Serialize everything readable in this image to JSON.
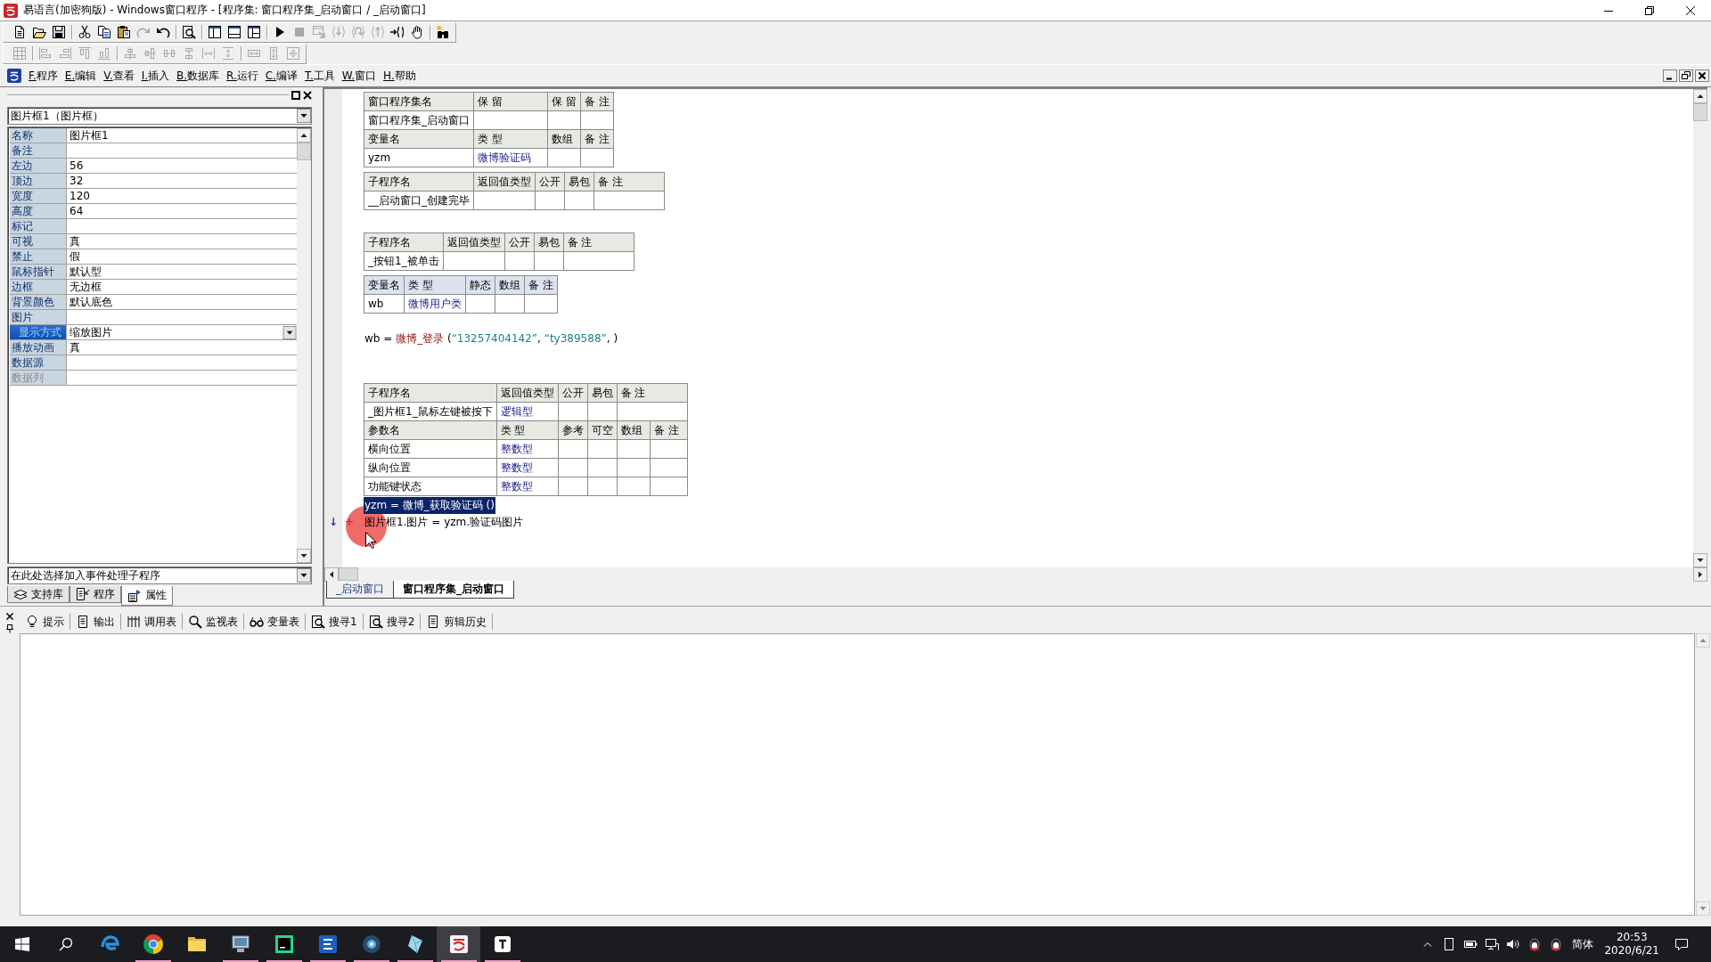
{
  "window": {
    "title": "易语言(加密狗版) - Windows窗口程序 - [程序集: 窗口程序集_启动窗口 / _启动窗口]"
  },
  "toolbars": [
    {
      "groups": [
        [
          {
            "kind": "new",
            "disabled": false
          },
          {
            "kind": "open",
            "disabled": false
          },
          {
            "kind": "save",
            "disabled": false
          }
        ],
        [
          {
            "kind": "cut",
            "disabled": false
          },
          {
            "kind": "copy",
            "disabled": false
          },
          {
            "kind": "paste",
            "disabled": false
          },
          {
            "kind": "redo",
            "disabled": true
          },
          {
            "kind": "undo",
            "disabled": false
          }
        ],
        [
          {
            "kind": "preview",
            "disabled": false
          }
        ],
        [
          {
            "kind": "paneleft",
            "disabled": false
          },
          {
            "kind": "panebottom",
            "disabled": false
          },
          {
            "kind": "panesplit",
            "disabled": false
          }
        ],
        [
          {
            "kind": "run",
            "disabled": false
          },
          {
            "kind": "stop",
            "disabled": true
          },
          {
            "kind": "debug",
            "disabled": true
          },
          {
            "kind": "stepin",
            "disabled": true
          },
          {
            "kind": "stepover",
            "disabled": true
          },
          {
            "kind": "stepout",
            "disabled": true
          },
          {
            "kind": "runto",
            "disabled": false
          },
          {
            "kind": "hand",
            "disabled": false
          }
        ],
        [
          {
            "kind": "finder",
            "disabled": false
          }
        ]
      ]
    },
    {
      "groups": [
        [
          {
            "kind": "grid",
            "disabled": true
          }
        ],
        [
          {
            "kind": "alignleft",
            "disabled": true
          },
          {
            "kind": "alignright",
            "disabled": true
          },
          {
            "kind": "aligntop",
            "disabled": true
          },
          {
            "kind": "alignbottom",
            "disabled": true
          }
        ],
        [
          {
            "kind": "centerh",
            "disabled": true
          },
          {
            "kind": "centerv",
            "disabled": true
          },
          {
            "kind": "spreadh",
            "disabled": true
          },
          {
            "kind": "spreadv",
            "disabled": true
          },
          {
            "kind": "spaceh",
            "disabled": true
          },
          {
            "kind": "spacev",
            "disabled": true
          }
        ],
        [
          {
            "kind": "samewidth",
            "disabled": true
          },
          {
            "kind": "sameheight",
            "disabled": true
          },
          {
            "kind": "samesize",
            "disabled": true
          }
        ]
      ]
    }
  ],
  "menu": {
    "items": [
      "F.程序",
      "E.编辑",
      "V.查看",
      "I.插入",
      "B.数据库",
      "R.运行",
      "C.编译",
      "T.工具",
      "W.窗口",
      "H.帮助"
    ]
  },
  "properties": {
    "object": "图片框1（图片框）",
    "rows": [
      {
        "name": "名称",
        "value": "图片框1",
        "selected": false,
        "disabled": false
      },
      {
        "name": "备注",
        "selected": false,
        "disabled": false
      },
      {
        "name": "左边",
        "value": "56",
        "selected": false,
        "disabled": false
      },
      {
        "name": "顶边",
        "value": "32",
        "selected": false,
        "disabled": false
      },
      {
        "name": "宽度",
        "value": "120",
        "selected": false,
        "disabled": false
      },
      {
        "name": "高度",
        "value": "64",
        "selected": false,
        "disabled": false
      },
      {
        "name": "标记",
        "selected": false,
        "disabled": false
      },
      {
        "name": "可视",
        "value": "真",
        "selected": false,
        "disabled": false
      },
      {
        "name": "禁止",
        "value": "假",
        "selected": false,
        "disabled": false
      },
      {
        "name": "鼠标指针",
        "value": "默认型",
        "selected": false,
        "disabled": false
      },
      {
        "name": "边框",
        "value": "无边框",
        "selected": false,
        "disabled": false
      },
      {
        "name": "背景颜色",
        "value": "默认底色",
        "selected": false,
        "disabled": false
      },
      {
        "name": "图片",
        "selected": false,
        "disabled": false
      },
      {
        "name": "显示方式",
        "value": "缩放图片",
        "selected": true,
        "disabled": false
      },
      {
        "name": "播放动画",
        "value": "真",
        "selected": false,
        "disabled": false
      },
      {
        "name": "数据源",
        "selected": false,
        "disabled": false
      },
      {
        "name": "数据列",
        "selected": false,
        "disabled": true
      }
    ],
    "event_picker": "在此处选择加入事件处理子程序",
    "tabs": [
      {
        "kind": "library",
        "label": "支持库",
        "selected": false
      },
      {
        "kind": "program",
        "label": "程序",
        "selected": false
      },
      {
        "kind": "attributes",
        "label": "属性",
        "selected": true
      }
    ]
  },
  "editor": {
    "blocks": [
      {
        "kind": "assembly",
        "rows": [
          {
            "kind": "header",
            "cells": [
              "窗口程序集名",
              "保 留",
              "保 留",
              "备 注"
            ]
          },
          {
            "kind": "data",
            "cells": [
              "窗口程序集_启动窗口"
            ]
          },
          {
            "kind": "header",
            "cells": [
              "变量名",
              "类 型",
              "数组",
              "备 注"
            ]
          },
          {
            "kind": "data",
            "cells": [
              "yzm",
              "微博验证码"
            ]
          }
        ]
      },
      {
        "kind": "sub",
        "rows": [
          {
            "kind": "header",
            "cells": [
              "子程序名",
              "返回值类型",
              "公开",
              "易包",
              "备 注"
            ]
          },
          {
            "kind": "data",
            "cells": [
              "__启动窗口_创建完毕"
            ]
          }
        ]
      },
      {
        "kind": "blank"
      },
      {
        "kind": "sub",
        "rows": [
          {
            "kind": "header",
            "cells": [
              "子程序名",
              "返回值类型",
              "公开",
              "易包",
              "备 注"
            ]
          },
          {
            "kind": "data",
            "cells": [
              "_按钮1_被单击"
            ]
          }
        ]
      },
      {
        "kind": "locals",
        "rows": [
          {
            "kind": "header",
            "cells": [
              "变量名",
              "类 型",
              "静态",
              "数组",
              "备 注"
            ]
          },
          {
            "kind": "data",
            "cells": [
              "wb",
              "微博用户类"
            ]
          }
        ]
      },
      {
        "kind": "code",
        "selected": false,
        "tokens": [
          {
            "kind": "plain",
            "text": "wb = "
          },
          {
            "kind": "call",
            "text": "微博_登录"
          },
          {
            "kind": "plain",
            "text": " ("
          },
          {
            "kind": "string",
            "text": "“13257404142”"
          },
          {
            "kind": "plain",
            "text": ", "
          },
          {
            "kind": "string",
            "text": "“ty389588”"
          },
          {
            "kind": "plain",
            "text": ", )"
          }
        ]
      },
      {
        "kind": "blank"
      },
      {
        "kind": "blank"
      },
      {
        "kind": "sub",
        "rows": [
          {
            "kind": "header",
            "cells": [
              "子程序名",
              "返回值类型",
              "公开",
              "易包",
              "备 注"
            ]
          },
          {
            "kind": "data",
            "cells": [
              "_图片框1_鼠标左键被按下",
              "逻辑型"
            ]
          }
        ]
      },
      {
        "kind": "params",
        "rows": [
          {
            "kind": "header",
            "cells": [
              "参数名",
              "类 型",
              "参考",
              "可空",
              "数组",
              "备 注"
            ]
          },
          {
            "kind": "data",
            "cells": [
              "横向位置",
              "整数型"
            ]
          },
          {
            "kind": "data",
            "cells": [
              "纵向位置",
              "整数型"
            ]
          },
          {
            "kind": "data",
            "cells": [
              "功能键状态",
              "整数型"
            ]
          }
        ]
      },
      {
        "kind": "code",
        "selected": true,
        "tokens": [
          {
            "kind": "plain",
            "text": "yzm = "
          },
          {
            "kind": "call",
            "text": "微博_获取验证码"
          },
          {
            "kind": "plain",
            "text": " ()"
          }
        ]
      },
      {
        "kind": "code",
        "selected": false,
        "gutter_marks": [
          {
            "kind": "arrow",
            "text": "↓"
          },
          {
            "kind": "add",
            "text": "+"
          }
        ],
        "tokens": [
          {
            "kind": "plain",
            "text": "图片框1.图片 = yzm.验证码图片"
          }
        ]
      }
    ],
    "tabs": [
      {
        "label": "_启动窗口",
        "selected": false
      },
      {
        "label": "窗口程序集_启动窗口",
        "selected": true
      }
    ]
  },
  "output_panel": {
    "tabs": [
      {
        "kind": "hint",
        "label": "提示"
      },
      {
        "kind": "output",
        "label": "输出"
      },
      {
        "kind": "callstack",
        "label": "调用表"
      },
      {
        "kind": "watch",
        "label": "监视表"
      },
      {
        "kind": "variables",
        "label": "变量表"
      },
      {
        "kind": "search",
        "label": "搜寻1"
      },
      {
        "kind": "search",
        "label": "搜寻2"
      },
      {
        "kind": "clipboard",
        "label": "剪辑历史"
      }
    ]
  },
  "taskbar": {
    "apps": [
      {
        "kind": "swirl",
        "running": false,
        "active": false
      },
      {
        "kind": "wheel",
        "running": true,
        "active": false
      },
      {
        "kind": "folder",
        "running": false,
        "active": false
      },
      {
        "kind": "computer",
        "running": true,
        "active": false
      },
      {
        "kind": "square",
        "running": true,
        "active": false
      },
      {
        "kind": "lines",
        "running": true,
        "active": false
      },
      {
        "kind": "disc",
        "running": true,
        "active": false
      },
      {
        "kind": "crystal",
        "running": true,
        "active": false
      },
      {
        "kind": "logo",
        "running": true,
        "active": true
      },
      {
        "kind": "tile",
        "running": true,
        "active": false
      }
    ],
    "tray": {
      "ime": "简体",
      "time": "20:53",
      "date": "2020/6/21"
    }
  }
}
